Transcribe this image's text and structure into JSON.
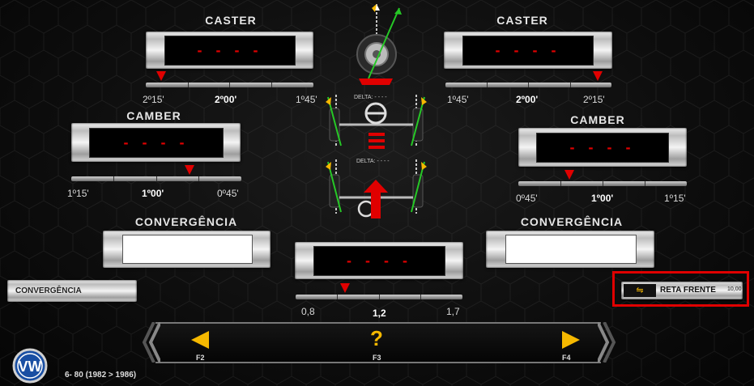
{
  "caster_left": {
    "title": "CASTER",
    "display": "- - - -",
    "scale": [
      "2º15'",
      "2º00'",
      "1º45'"
    ]
  },
  "caster_right": {
    "title": "CASTER",
    "display": "- - - -",
    "scale": [
      "1º45'",
      "2º00'",
      "2º15'"
    ]
  },
  "camber_left": {
    "title": "CAMBER",
    "display": "- - - -",
    "scale": [
      "1º15'",
      "1º00'",
      "0º45'"
    ]
  },
  "camber_right": {
    "title": "CAMBER",
    "display": "- - - -",
    "scale": [
      "0º45'",
      "1º00'",
      "1º15'"
    ]
  },
  "conv_left": {
    "title": "CONVERGÊNCIA"
  },
  "conv_right": {
    "title": "CONVERGÊNCIA"
  },
  "conv_total": {
    "display": "- - - -",
    "scale": [
      "0,8",
      "1,2",
      "1,7"
    ]
  },
  "delta": {
    "top": "DELTA:  - - - -",
    "bottom": "DELTA:  - - - -"
  },
  "buttons": {
    "convergencia": "CONVERGÊNCIA",
    "reta_frente": "RETA FRENTE",
    "reta_frente_value": "10,00"
  },
  "nav": {
    "f2": "F2",
    "f3": "F3",
    "f4": "F4",
    "help": "?"
  },
  "vehicle": {
    "model": "6- 80  (1982 > 1986)",
    "logo": "VW"
  },
  "colors": {
    "accent": "#e00000",
    "nav_arrow": "#f5b800",
    "highlight_border": "#e00000"
  }
}
